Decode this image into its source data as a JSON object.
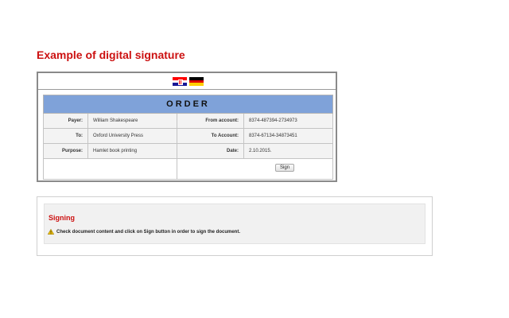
{
  "page": {
    "title": "Example of digital signature"
  },
  "languages": [
    {
      "icon": "croatian-flag-icon",
      "colors": [
        "#ff0000",
        "#ffffff",
        "#171796"
      ]
    },
    {
      "icon": "german-flag-icon",
      "colors": [
        "#000000",
        "#dd0000",
        "#ffce00"
      ]
    }
  ],
  "order": {
    "heading": "ORDER",
    "header_color": "#7fa2d9",
    "payer_label": "Payer:",
    "payer_value": "William Shakespeare",
    "from_account_label": "From account:",
    "from_account_value": "8374-487394-2734973",
    "to_label": "To:",
    "to_value": "Oxford University Press",
    "to_account_label": "To Account:",
    "to_account_value": "8374-67134-34873451",
    "purpose_label": "Purpose:",
    "purpose_value": "Hamlet book printing",
    "date_label": "Date:",
    "date_value": "2.10.2015.",
    "sign_button_label": "Sign"
  },
  "signing": {
    "title": "Signing",
    "message": "Check document content and click on Sign button in order to sign the document.",
    "icon": "warning-icon",
    "accent_color": "#cc1111"
  }
}
